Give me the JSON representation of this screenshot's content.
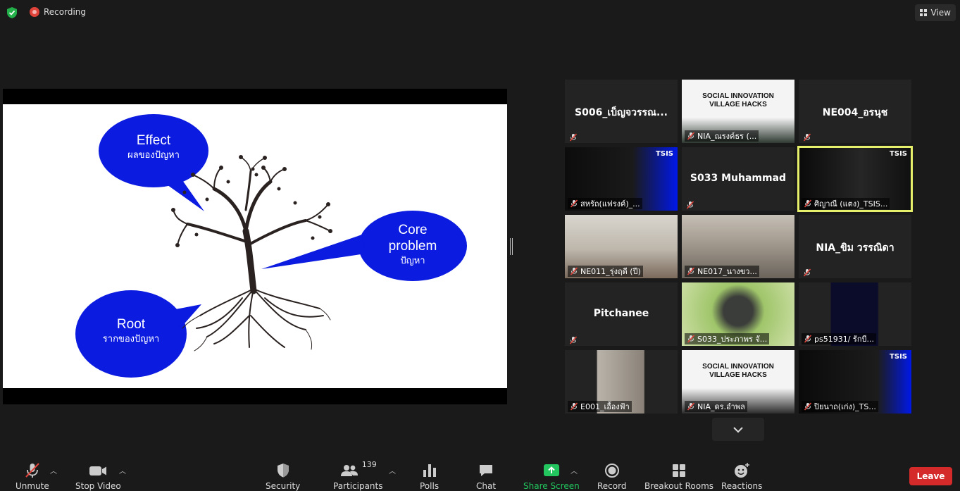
{
  "topbar": {
    "recording_label": "Recording",
    "view_label": "View"
  },
  "slide": {
    "effect": {
      "title": "Effect",
      "subtitle": "ผลของปัญหา"
    },
    "core": {
      "title_line1": "Core",
      "title_line2": "problem",
      "subtitle": "ปัญหา"
    },
    "root": {
      "title": "Root",
      "subtitle": "รากของปัญหา"
    },
    "bubble_color": "#0b1be0"
  },
  "participants": [
    {
      "label": "S006_เบ็ญจวรรณ...",
      "kind": "name"
    },
    {
      "label": "NIA_ณรงค์ธร (...",
      "kind": "video",
      "poster_title": "SOCIAL INNOVATION VILLAGE HACKS"
    },
    {
      "label": "NE004_อรนุช",
      "kind": "name"
    },
    {
      "label": "สหรัถ(แฟรงค์)_...",
      "kind": "video",
      "badge": "TSIS"
    },
    {
      "label": "S033 Muhammad",
      "kind": "name"
    },
    {
      "label": "ศิญาณี (แตง)_TSIS...",
      "kind": "video",
      "badge": "TSIS",
      "active": true
    },
    {
      "label": "NE011_รุ่งฤดี (ปี)",
      "kind": "video"
    },
    {
      "label": "NE017_นางขว...",
      "kind": "video"
    },
    {
      "label": "NIA_ขิม วรรณิดา",
      "kind": "name"
    },
    {
      "label": "Pitchanee",
      "kind": "name"
    },
    {
      "label": "S033_ประภาพร จั...",
      "kind": "video"
    },
    {
      "label": "ps51931/ รักบี...",
      "kind": "video"
    },
    {
      "label": "E001_เอื้องฟ้า",
      "kind": "video"
    },
    {
      "label": "NIA_ดร.อำพล",
      "kind": "video",
      "poster_title": "SOCIAL INNOVATION VILLAGE HACKS"
    },
    {
      "label": "ปิยนาถ(เก่ง)_TS...",
      "kind": "video",
      "badge": "TSIS"
    }
  ],
  "toolbar": {
    "unmute": "Unmute",
    "stop_video": "Stop Video",
    "security": "Security",
    "participants": "Participants",
    "participant_count": "139",
    "polls": "Polls",
    "chat": "Chat",
    "share_screen": "Share Screen",
    "record": "Record",
    "breakout_rooms": "Breakout Rooms",
    "reactions": "Reactions",
    "leave": "Leave",
    "share_color": "#22c55e",
    "leave_color": "#d42a2a"
  }
}
